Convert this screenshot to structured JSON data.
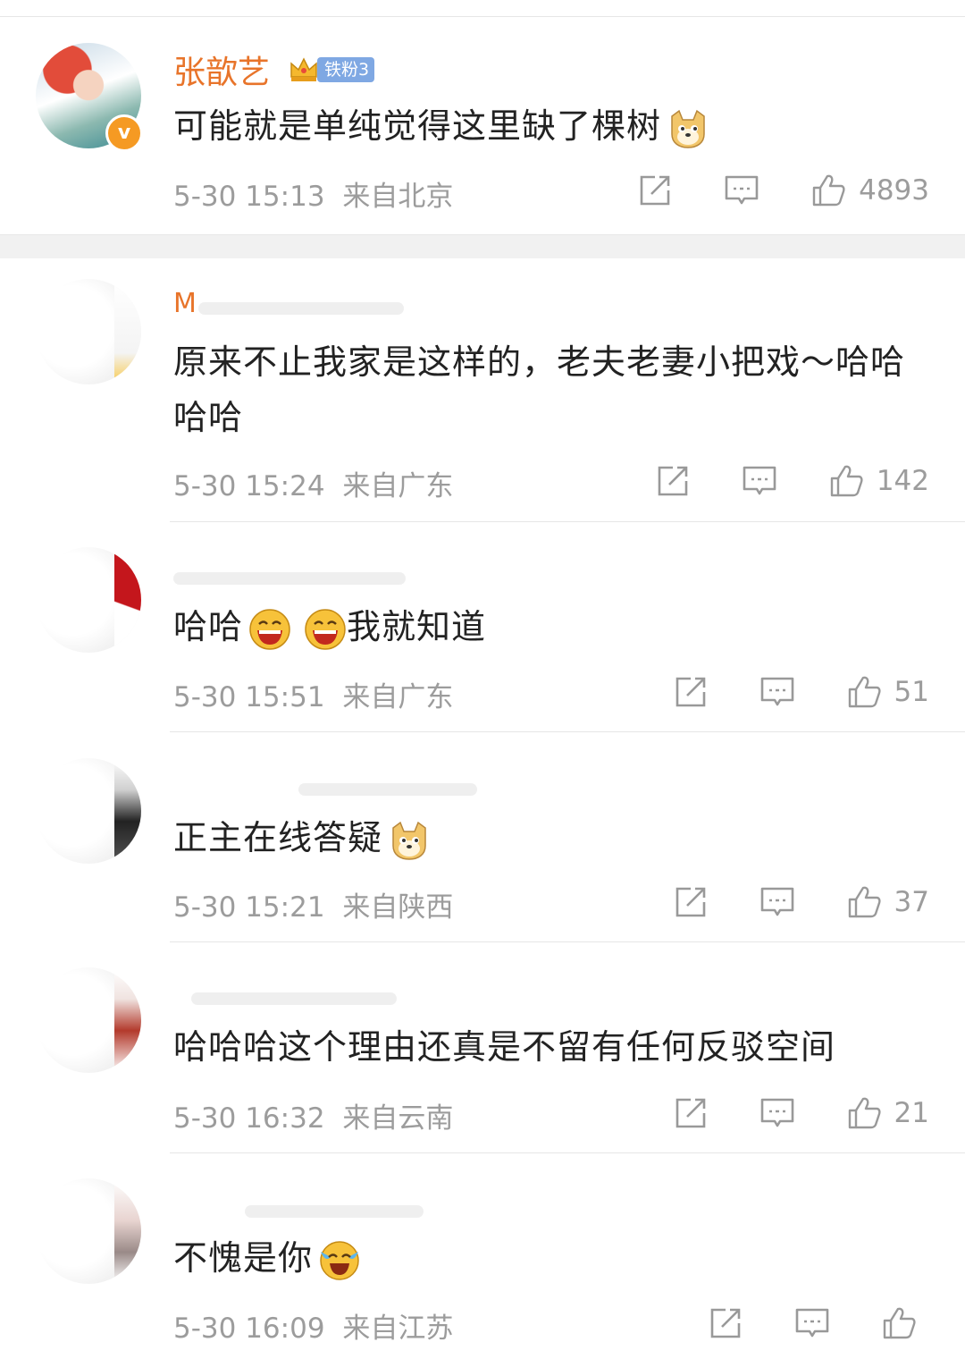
{
  "colors": {
    "username": "#e8742a",
    "meta": "#9c9c9c",
    "badge": "#7fa8e3"
  },
  "comments": [
    {
      "username": "张歆艺",
      "badge": "铁粉3",
      "text": "可能就是单纯觉得这里缺了棵树",
      "emoji": [
        "doge-emoji"
      ],
      "time": "5-30 15:13",
      "location": "来自北京",
      "likes": "4893"
    },
    {
      "username": "M",
      "text": "原来不止我家是这样的，老夫老妻小把戏～哈哈哈哈",
      "emoji": [],
      "time": "5-30 15:24",
      "location": "来自广东",
      "likes": "142"
    },
    {
      "text_a": "哈哈",
      "text_b": "我就知道",
      "emoji": [
        "laugh-emoji",
        "laugh-emoji"
      ],
      "time": "5-30 15:51",
      "location": "来自广东",
      "likes": "51"
    },
    {
      "text": "正主在线答疑",
      "emoji": [
        "doge-emoji"
      ],
      "time": "5-30 15:21",
      "location": "来自陕西",
      "likes": "37"
    },
    {
      "text": "哈哈哈这个理由还真是不留有任何反驳空间",
      "emoji": [],
      "time": "5-30 16:32",
      "location": "来自云南",
      "likes": "21"
    },
    {
      "text": "不愧是你",
      "emoji": [
        "cry-laugh-emoji"
      ],
      "time": "5-30 16:09",
      "location": "来自江苏",
      "likes": ""
    }
  ]
}
